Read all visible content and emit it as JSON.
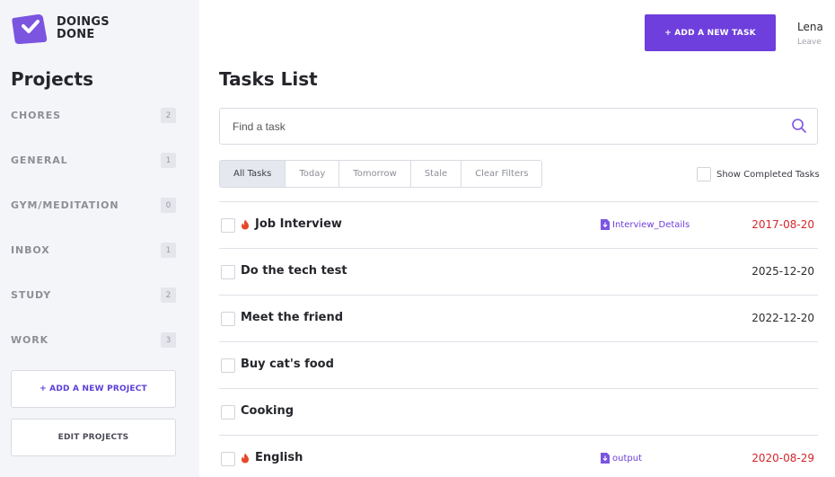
{
  "app": {
    "logo_line1": "DOINGS",
    "logo_line2": "DONE"
  },
  "sidebar": {
    "title": "Projects",
    "projects": [
      {
        "name": "CHORES",
        "count": "2"
      },
      {
        "name": "GENERAL",
        "count": "1"
      },
      {
        "name": "GYM/MEDITATION",
        "count": "0"
      },
      {
        "name": "INBOX",
        "count": "1"
      },
      {
        "name": "STUDY",
        "count": "2"
      },
      {
        "name": "WORK",
        "count": "3"
      }
    ],
    "add_project_label": "+ ADD A NEW PROJECT",
    "edit_projects_label": "EDIT PROJECTS"
  },
  "header": {
    "add_task_label": "+ ADD A NEW TASK",
    "user_name": "Lena",
    "leave_label": "Leave"
  },
  "main": {
    "title": "Tasks List",
    "search_placeholder": "Find a task",
    "filters": [
      "All Tasks",
      "Today",
      "Tomorrow",
      "Stale",
      "Clear Filters"
    ],
    "active_filter": "All Tasks",
    "show_completed_label": "Show Completed Tasks",
    "tasks": [
      {
        "title": "Job Interview",
        "priority": true,
        "file": "Interview_Details",
        "date": "2017-08-20",
        "overdue": true
      },
      {
        "title": "Do the tech test",
        "priority": false,
        "file": "",
        "date": "2025-12-20",
        "overdue": false
      },
      {
        "title": "Meet the friend",
        "priority": false,
        "file": "",
        "date": "2022-12-20",
        "overdue": false
      },
      {
        "title": "Buy cat's food",
        "priority": false,
        "file": "",
        "date": "",
        "overdue": false
      },
      {
        "title": "Cooking",
        "priority": false,
        "file": "",
        "date": "",
        "overdue": false
      },
      {
        "title": "English",
        "priority": true,
        "file": "output",
        "date": "2020-08-29",
        "overdue": true
      }
    ]
  },
  "colors": {
    "accent": "#6e3fdc",
    "overdue": "#d5262c",
    "sidebar_bg": "#f4f5f9"
  }
}
